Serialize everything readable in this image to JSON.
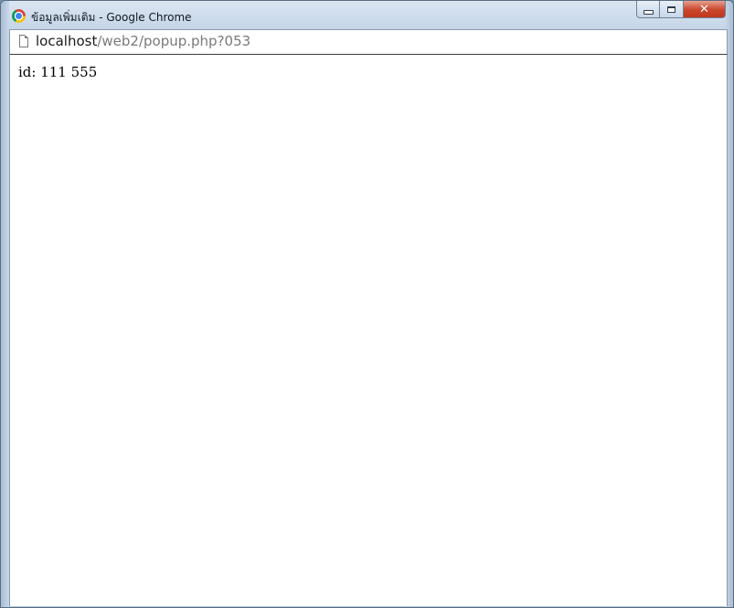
{
  "window": {
    "title": "ข้อมูลเพิ่มเติม - Google Chrome",
    "browser_icon": "chrome-icon",
    "controls": {
      "minimize_icon": "minimize-icon",
      "maximize_icon": "maximize-icon",
      "close_label": "✕"
    }
  },
  "address_bar": {
    "page_icon": "page-icon",
    "host": "localhost",
    "path": "/web2/popup.php?053"
  },
  "page": {
    "text": "id: 111 555"
  },
  "colors": {
    "close_button": "#c9452b",
    "title_bar": "#c6d6e8",
    "url_path": "#7a7a7a"
  }
}
